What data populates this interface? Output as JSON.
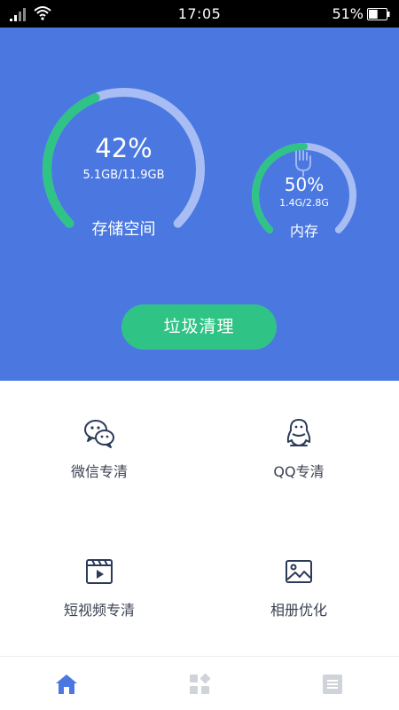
{
  "status_bar": {
    "time": "17:05",
    "battery_text": "51%",
    "battery_level": 0.51
  },
  "storage": {
    "percent_text": "42%",
    "percent": 42,
    "detail": "5.1GB/11.9GB",
    "label": "存储空间"
  },
  "memory": {
    "percent_text": "50%",
    "percent": 50,
    "detail": "1.4G/2.8G",
    "label": "内存"
  },
  "clean_button": {
    "label": "垃圾清理"
  },
  "features": {
    "wechat": {
      "label": "微信专清",
      "icon": "wechat-icon"
    },
    "qq": {
      "label": "QQ专清",
      "icon": "qq-penguin-icon"
    },
    "video": {
      "label": "短视频专清",
      "icon": "video-clapper-icon"
    },
    "album": {
      "label": "相册优化",
      "icon": "photo-album-icon"
    }
  },
  "tabs": [
    {
      "name": "home",
      "icon": "home-icon",
      "active": true
    },
    {
      "name": "apps",
      "icon": "apps-grid-icon",
      "active": false
    },
    {
      "name": "list",
      "icon": "list-icon",
      "active": false
    }
  ],
  "colors": {
    "hero_bg": "#4a78e0",
    "accent_green": "#2fc486",
    "ring_track": "#a9bdf5",
    "text_dark": "#3a4150",
    "tab_active": "#4a78e0",
    "tab_inactive": "#d0d3d9"
  }
}
